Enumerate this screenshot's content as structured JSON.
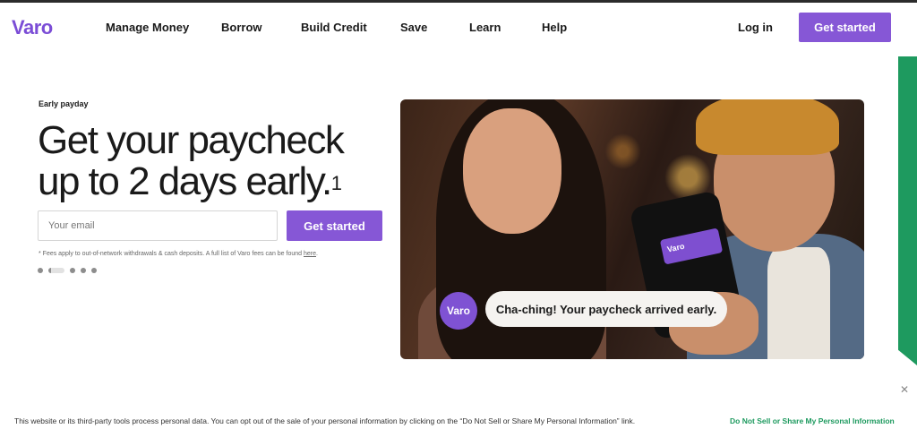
{
  "header": {
    "logo": "Varo",
    "nav": [
      "Manage Money",
      "Borrow",
      "Build Credit",
      "Save",
      "Learn",
      "Help"
    ],
    "login_label": "Log in",
    "cta_label": "Get started"
  },
  "hero": {
    "eyebrow": "Early payday",
    "headline": "Get your paycheck up to 2 days early.",
    "headline_sup": "1",
    "email_placeholder": "Your email",
    "email_value": "",
    "cta_label": "Get started",
    "disclaimer": "* Fees apply to out-of-network withdrawals & cash deposits. A full list of Varo fees can be found ",
    "disclaimer_link": "here",
    "disclaimer_end": ".",
    "carousel": {
      "total": 5,
      "active_index": 1
    }
  },
  "image_overlay": {
    "badge": "Varo",
    "card_label": "Varo",
    "message": "Cha-ching! Your paycheck arrived early."
  },
  "cookie_banner": {
    "text": "This website or its third-party tools process personal data. You can opt out of the sale of your personal information by clicking on the “Do Not Sell or Share My Personal Information” link.",
    "link": "Do Not Sell or Share My Personal Information",
    "close_icon": "close-icon"
  },
  "colors": {
    "accent": "#8657d6",
    "green": "#1e9a5f",
    "text": "#1a1a1a"
  }
}
